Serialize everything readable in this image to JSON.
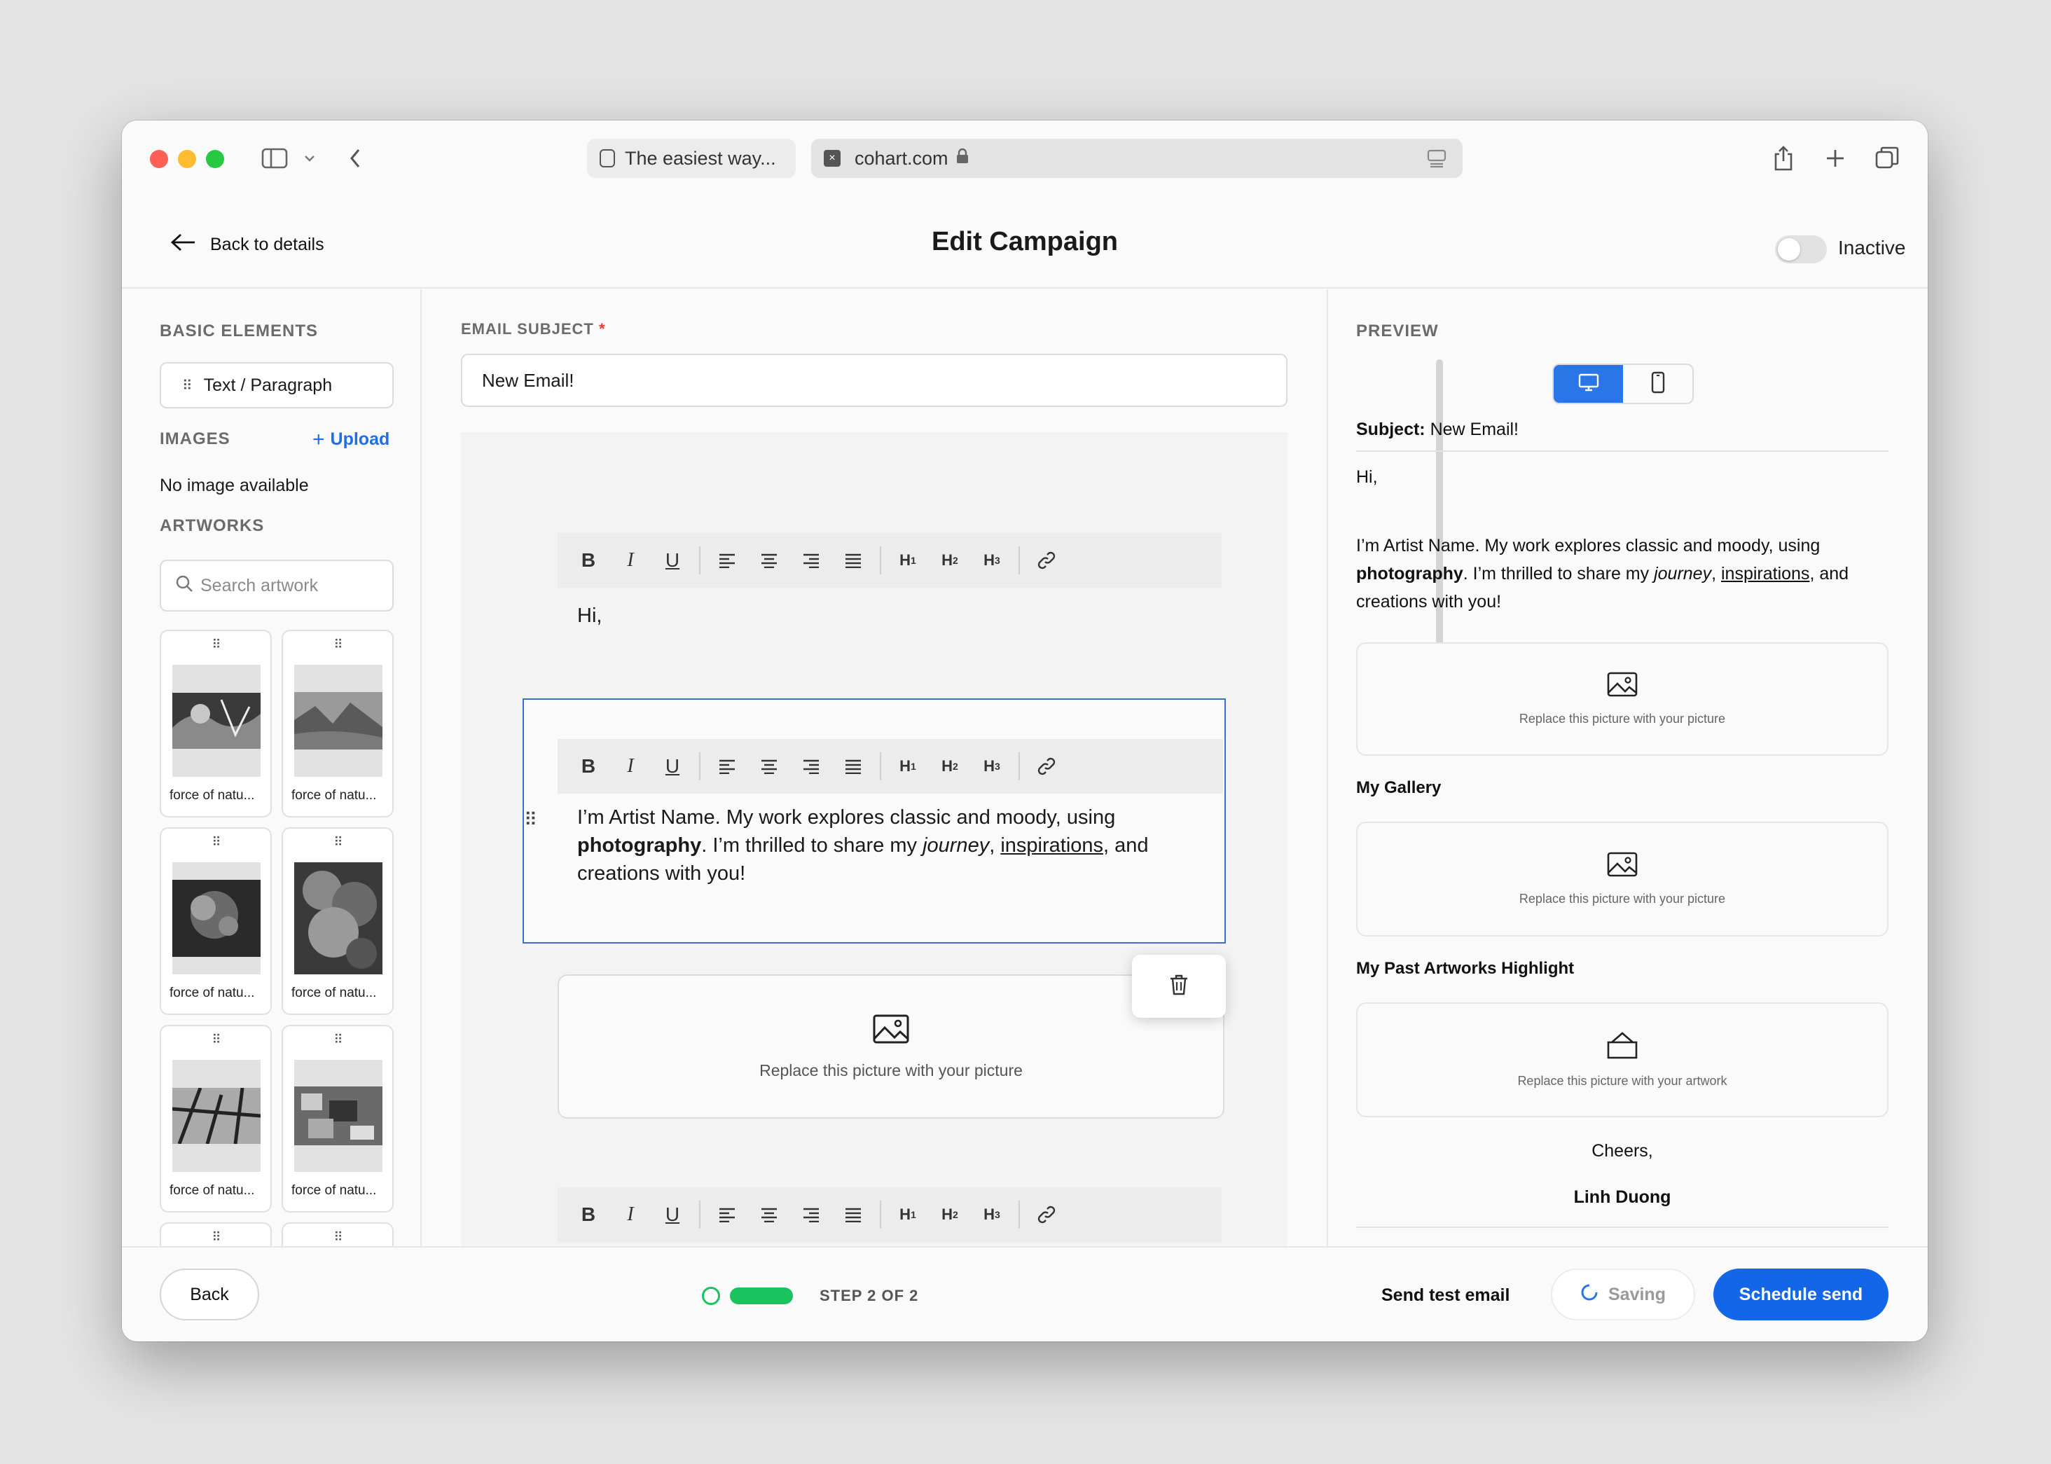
{
  "browser": {
    "tab1_title": "The easiest way...",
    "address": "cohart.com"
  },
  "header": {
    "back_label": "Back to details",
    "title": "Edit Campaign",
    "status_label": "Inactive"
  },
  "left_panel": {
    "basic_elements_heading": "BASIC ELEMENTS",
    "text_paragraph_label": "Text / Paragraph",
    "images_heading": "IMAGES",
    "upload_label": "Upload",
    "no_image_text": "No image available",
    "artworks_heading": "ARTWORKS",
    "search_placeholder": "Search artwork",
    "artworks": [
      {
        "caption": "force of natu..."
      },
      {
        "caption": "force of natu..."
      },
      {
        "caption": "force of natu..."
      },
      {
        "caption": "force of natu..."
      },
      {
        "caption": "force of natu..."
      },
      {
        "caption": "force of natu..."
      }
    ]
  },
  "editor": {
    "subject_label": "EMAIL SUBJECT",
    "subject_required_mark": "*",
    "subject_value": "New Email!",
    "greeting": "Hi,",
    "paragraph": {
      "p1": "I’m Artist Name. My work explores classic and moody, using",
      "bold": "photography",
      "p2": ". I’m thrilled to share my ",
      "italic": "journey",
      "p3": ", ",
      "underline": "inspirations",
      "p4": ", and",
      "p5": "creations with you!"
    },
    "image_placeholder": "Replace this picture with your picture"
  },
  "preview": {
    "heading": "PREVIEW",
    "subject_prefix": "Subject:",
    "subject_value": "New Email!",
    "greeting": "Hi,",
    "paragraph": {
      "p1": "I’m Artist Name. My work explores classic and moody, using",
      "bold": "photography",
      "p2": ". I’m thrilled to share my ",
      "italic": "journey",
      "p3": ", ",
      "underline": "inspirations",
      "p4": ", and",
      "p5": "creations with you!"
    },
    "image_placeholder": "Replace this picture with your picture",
    "gallery_heading": "My Gallery",
    "past_heading": "My Past Artworks Highlight",
    "artwork_placeholder": "Replace this picture with your artwork",
    "signoff": "Cheers,",
    "signature": "Linh Duong"
  },
  "footer": {
    "back_label": "Back",
    "step_text": "STEP 2 OF 2",
    "step_progress": 1.0,
    "send_test_label": "Send test email",
    "saving_label": "Saving",
    "schedule_label": "Schedule send"
  },
  "colors": {
    "accent": "#1466e8",
    "progress": "#1bc260",
    "selection": "#3a6fd0"
  }
}
